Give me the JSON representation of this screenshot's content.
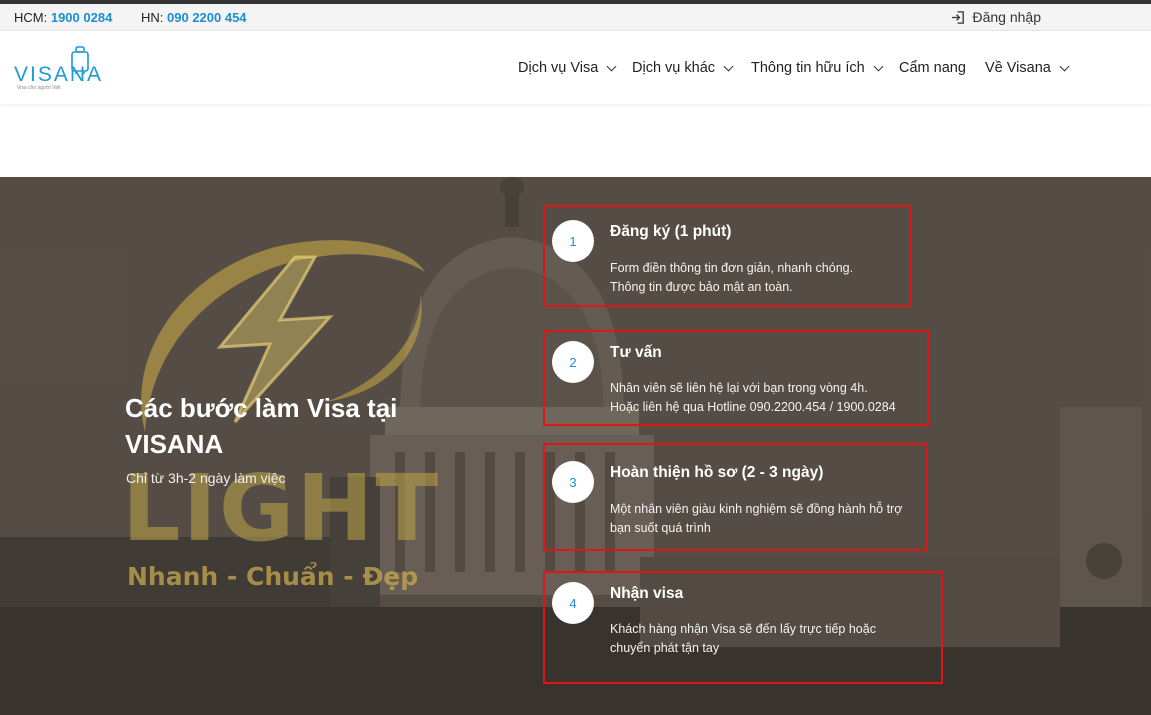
{
  "topbar": {
    "hcm_label": "HCM:",
    "hcm_number": "1900 0284",
    "hn_label": "HN:",
    "hn_number": "090 2200 454",
    "login_label": "Đăng nhập"
  },
  "logo": {
    "text": "VISANA",
    "tagline": "Visa cho người Việt"
  },
  "nav": {
    "items": [
      {
        "label": "Dịch vụ Visa"
      },
      {
        "label": "Dịch vụ khác"
      },
      {
        "label": "Thông tin hữu ích"
      },
      {
        "label": "Cẩm nang"
      },
      {
        "label": "Về Visana"
      }
    ]
  },
  "hero": {
    "title": "Các bước làm Visa tại VISANA",
    "subtitle": "Chỉ từ 3h-2 ngày làm việc",
    "banner_word": "LIGHT",
    "banner_slogan": "Nhanh - Chuẩn - Đẹp"
  },
  "steps": [
    {
      "number": "1",
      "title": "Đăng ký (1 phút)",
      "line1": "Form điền thông tin đơn giản, nhanh chóng.",
      "line2": "Thông tin được bảo mật an toàn."
    },
    {
      "number": "2",
      "title": "Tư vấn",
      "line1": "Nhân viên sẽ liên hệ lại với bạn trong vòng 4h.",
      "line2": "Hoặc liên hệ qua Hotline 090.2200.454 / 1900.0284"
    },
    {
      "number": "3",
      "title": "Hoàn thiện hồ sơ (2 - 3 ngày)",
      "line1": "Một nhân viên giàu kinh nghiệm sẽ đồng hành hỗ trợ",
      "line2": "bạn suốt quá trình"
    },
    {
      "number": "4",
      "title": "Nhận visa",
      "line1": "Khách hàng nhận Visa sẽ đến lấy trực tiếp hoặc",
      "line2": "chuyển phát tận tay"
    }
  ],
  "colors": {
    "accent": "#1a8fd1",
    "highlight_border": "#e01515",
    "banner_gold": "#c8aa50"
  }
}
